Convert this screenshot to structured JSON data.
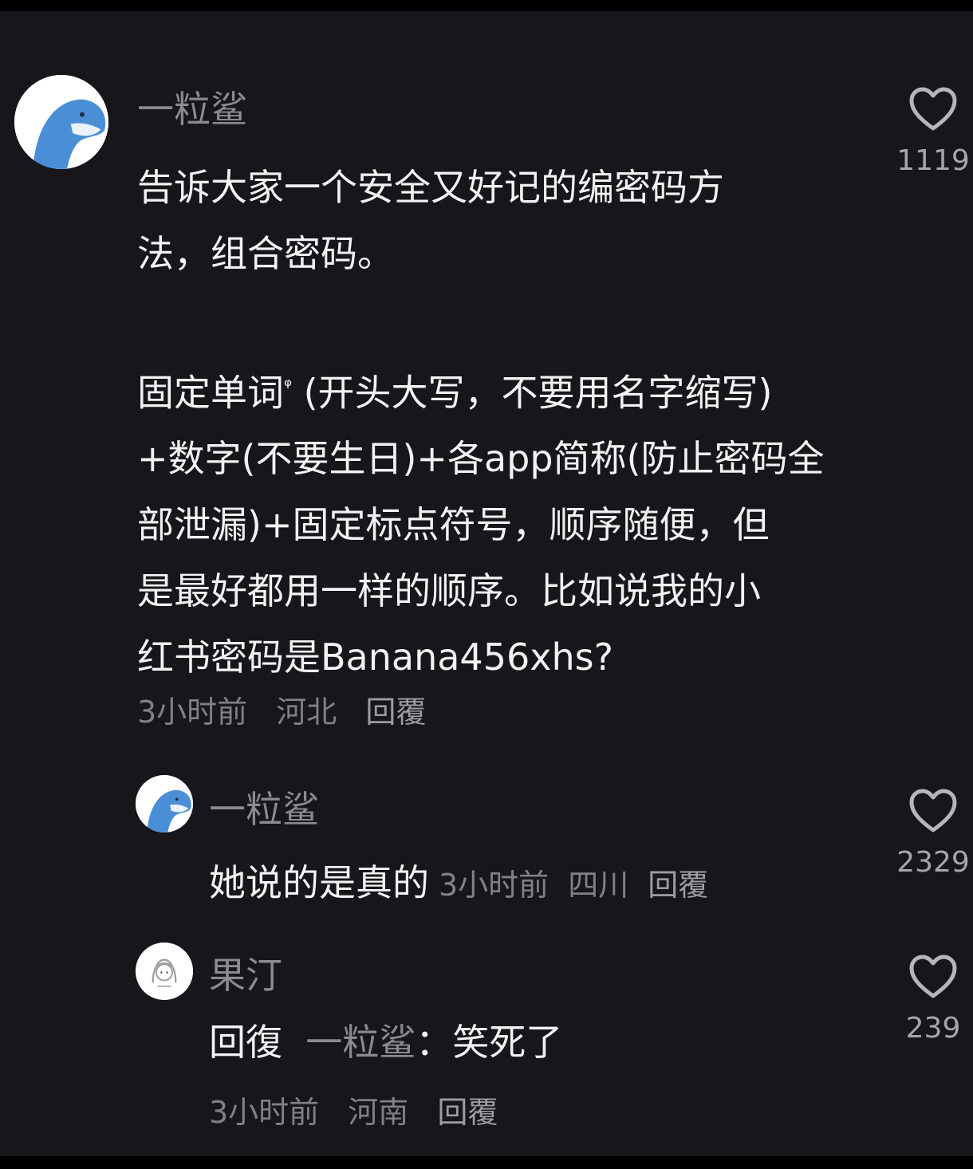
{
  "comment": {
    "username": "一粒鲨",
    "paragraph1": "告诉大家一个安全又好记的编密码方\n法，组合密码。",
    "paragraph2_keyword": "固定单词",
    "paragraph2": " (开头大写，不要用名字缩写)\n+数字(不要生日)+各app简称(防止密码全\n部泄漏)+固定标点符号，顺序随便，但\n是最好都用一样的顺序。比如说我的小\n红书密码是Banana456xhs?",
    "time": "3小时前",
    "location": "河北",
    "reply_label": "回覆",
    "likes": "1119"
  },
  "replies": [
    {
      "username": "一粒鲨",
      "text": "她说的是真的",
      "time": "3小时前",
      "location": "四川",
      "reply_label": "回覆",
      "likes": "2329"
    },
    {
      "username": "果汀",
      "reply_prefix": "回復",
      "mention": "一粒鲨",
      "text": "：笑死了",
      "time": "3小时前",
      "location": "河南",
      "reply_label": "回覆",
      "likes": "239"
    }
  ],
  "colors": {
    "background": "#16161b",
    "text": "#f2f2f2",
    "muted": "#8a8a90",
    "avatar_accent": "#4a8fd6"
  }
}
